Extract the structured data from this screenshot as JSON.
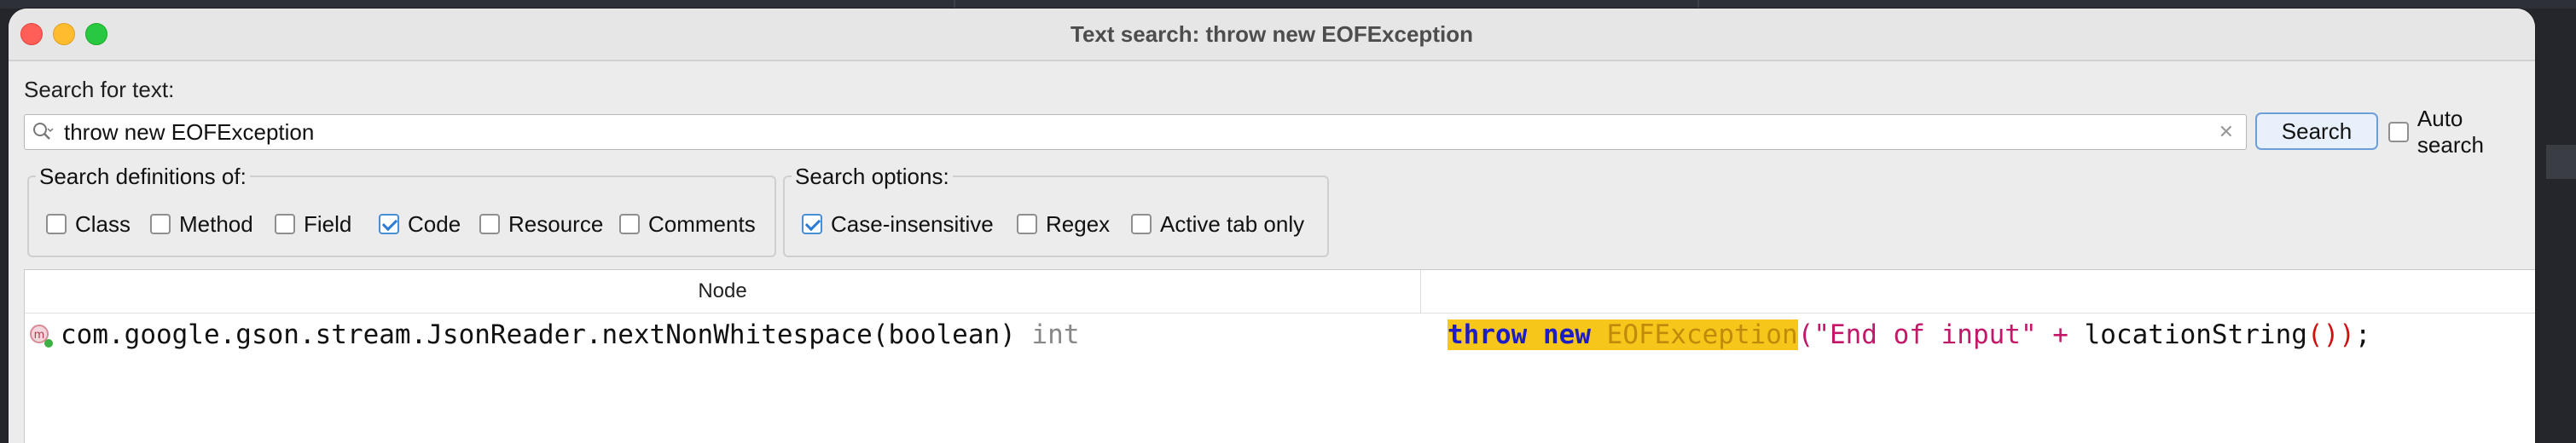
{
  "window": {
    "title": "Text search: throw new EOFException"
  },
  "search": {
    "label": "Search for text:",
    "value": "throw new EOFException",
    "button_label": "Search",
    "auto_search_label": "Auto search",
    "auto_search_checked": false
  },
  "definitions": {
    "legend": "Search definitions of:",
    "items": [
      {
        "label": "Class",
        "checked": false
      },
      {
        "label": "Method",
        "checked": false
      },
      {
        "label": "Field",
        "checked": false
      },
      {
        "label": "Code",
        "checked": true
      },
      {
        "label": "Resource",
        "checked": false
      },
      {
        "label": "Comments",
        "checked": false
      }
    ]
  },
  "options": {
    "legend": "Search options:",
    "items": [
      {
        "label": "Case-insensitive",
        "checked": true
      },
      {
        "label": "Regex",
        "checked": false
      },
      {
        "label": "Active tab only",
        "checked": false
      }
    ]
  },
  "results": {
    "columns": [
      "Node",
      ""
    ],
    "rows": [
      {
        "node": "com.google.gson.stream.JsonReader.nextNonWhitespace(boolean)",
        "return_type": "int",
        "code": {
          "kw1": "throw",
          "kw2": "new",
          "class_name": "EOFException",
          "open_paren": "(",
          "string": "\"End of input\"",
          "op": "+",
          "call": "locationString",
          "call_parens": "()",
          "close": ")",
          "semicolon": ";"
        }
      }
    ]
  },
  "colors": {
    "highlight": "#f6c71a",
    "keyword": "#1d1dc6",
    "string": "#c2186a",
    "accent": "#2f7bd4"
  }
}
